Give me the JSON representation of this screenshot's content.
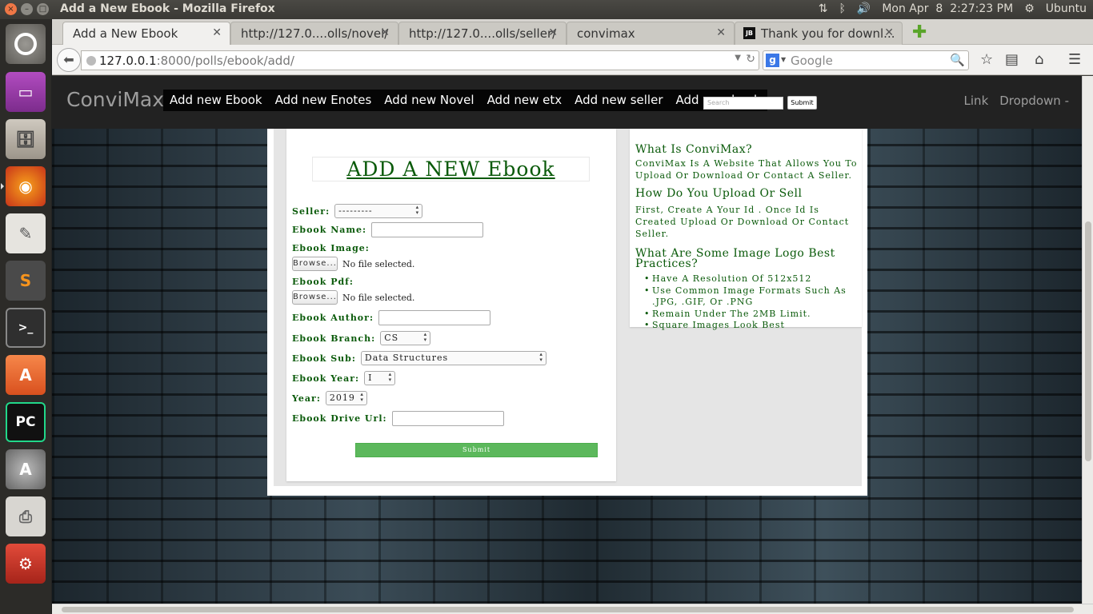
{
  "window": {
    "title": "Add a New Ebook - Mozilla Firefox",
    "clock": "Mon Apr  8  2:27:23 PM",
    "user": "Ubuntu"
  },
  "tabs": [
    {
      "label": "Add a New Ebook"
    },
    {
      "label": "http://127.0....olls/novel/"
    },
    {
      "label": "http://127.0....olls/seller/"
    },
    {
      "label": "convimax"
    },
    {
      "label": "Thank you for downl..."
    }
  ],
  "urlbar": {
    "host": "127.0.0.1",
    "path": ":8000/polls/ebook/add/"
  },
  "searchbar": {
    "placeholder": "Google"
  },
  "site": {
    "brand": "ConviMax",
    "nav": [
      "Add new Ebook",
      "Add new Enotes",
      "Add new Novel",
      "Add new etx",
      "Add new seller",
      "Add new book"
    ],
    "search_placeholder": "Search",
    "search_submit": "Submit",
    "right_link": "Link",
    "right_dropdown": "Dropdown -"
  },
  "form": {
    "title": "ADD A NEW Ebook",
    "seller_label": "Seller:",
    "seller_value": "---------",
    "name_label": "Ebook Name:",
    "image_label": "Ebook Image:",
    "pdf_label": "Ebook Pdf:",
    "browse": "Browse...",
    "no_file": "No file selected.",
    "author_label": "Ebook Author:",
    "branch_label": "Ebook Branch:",
    "branch_value": "CS",
    "sub_label": "Ebook Sub:",
    "sub_value": "Data Structures",
    "ebook_year_label": "Ebook Year:",
    "ebook_year_value": "I",
    "year_label": "Year:",
    "year_value": "2019",
    "drive_label": "Ebook Drive Url:",
    "submit": "Submit"
  },
  "info": {
    "h1": "What Is ConviMax?",
    "p1": "ConviMax Is A Website That Allows You To Upload Or Download Or Contact A Seller.",
    "h2": "How Do You Upload Or Sell",
    "p2": "First, Create A Your Id . Once Id Is Created Upload Or Download Or Contact Seller.",
    "h3": "What Are Some Image Logo Best Practices?",
    "bullets": [
      "Have A Resolution Of 512x512",
      "Use Common Image Formats Such As .JPG, .GIF, Or .PNG",
      "Remain Under The 2MB Limit.",
      "Square Images Look Best"
    ]
  }
}
